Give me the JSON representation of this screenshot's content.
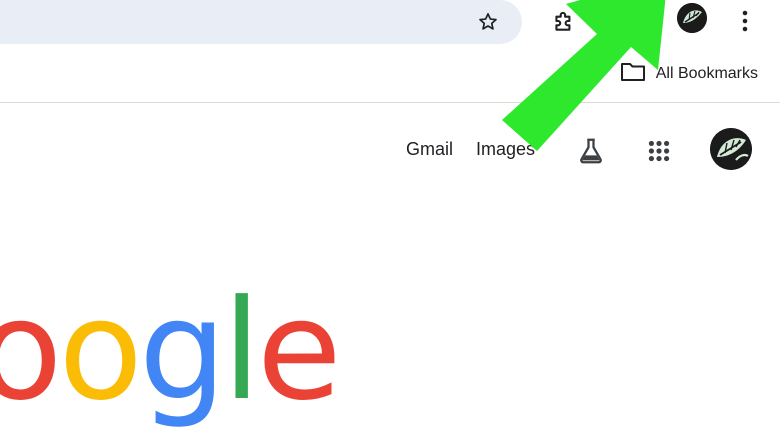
{
  "toolbar": {
    "icons": [
      "star-icon",
      "extensions-icon",
      "profile-avatar",
      "more-menu-icon"
    ]
  },
  "bookmarks_bar": {
    "all_bookmarks_label": "All Bookmarks",
    "folder_icon": "folder-icon"
  },
  "google_header": {
    "gmail_label": "Gmail",
    "images_label": "Images",
    "icons": [
      "labs-flask-icon",
      "apps-grid-icon",
      "account-avatar"
    ]
  },
  "logo": {
    "letters": [
      "o",
      "o",
      "g",
      "l",
      "e"
    ],
    "colors": [
      "#ea4335",
      "#fbbc05",
      "#4285f4",
      "#34a853",
      "#ea4335"
    ]
  },
  "annotation": {
    "arrow_color": "#2ee82e"
  }
}
